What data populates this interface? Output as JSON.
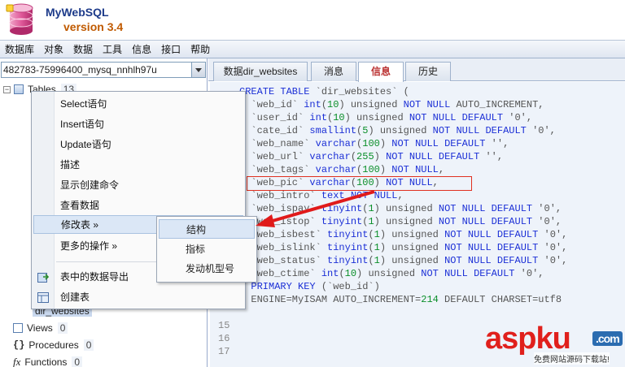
{
  "app": {
    "name": "MyWebSQL",
    "version": "version 3.4"
  },
  "menubar": [
    "数据库",
    "对象",
    "数据",
    "工具",
    "信息",
    "接口",
    "帮助"
  ],
  "database_selector": {
    "value": "482783-75996400_mysq_nnhlh97u"
  },
  "tree": {
    "tables_label": "Tables",
    "tables_count": "13",
    "selected_table": "dir_websites",
    "views_label": "Views",
    "views_count": "0",
    "procedures_label": "Procedures",
    "procedures_count": "0",
    "functions_label": "Functions",
    "functions_count": "0"
  },
  "context_menu": {
    "items": [
      "Select语句",
      "Insert语句",
      "Update语句",
      "描述",
      "显示创建命令",
      "查看数据",
      "修改表 »",
      "更多的操作 »",
      "表中的数据导出",
      "创建表"
    ],
    "submenu": [
      "结构",
      "指标",
      "发动机型号"
    ]
  },
  "tabs": [
    "数据dir_websites",
    "消息",
    "信息",
    "历史"
  ],
  "active_tab": "信息",
  "editor": {
    "lines": [
      {
        "n": "",
        "parts": [
          [
            "kw",
            "CREATE TABLE "
          ],
          [
            "str",
            "`dir_websites` ("
          ]
        ]
      },
      {
        "n": "",
        "parts": [
          [
            "str",
            "  `web_id` "
          ],
          [
            "kw",
            "int"
          ],
          [
            "str",
            "("
          ],
          [
            "num",
            "10"
          ],
          [
            "str",
            ") unsigned "
          ],
          [
            "kw",
            "NOT NULL"
          ],
          [
            "str",
            " AUTO_INCREMENT,"
          ]
        ]
      },
      {
        "n": "",
        "parts": [
          [
            "str",
            "  `user_id` "
          ],
          [
            "kw",
            "int"
          ],
          [
            "str",
            "("
          ],
          [
            "num",
            "10"
          ],
          [
            "str",
            ") unsigned "
          ],
          [
            "kw",
            "NOT NULL DEFAULT"
          ],
          [
            "str",
            " '0',"
          ]
        ]
      },
      {
        "n": "",
        "parts": [
          [
            "str",
            "  `cate_id` "
          ],
          [
            "kw",
            "smallint"
          ],
          [
            "str",
            "("
          ],
          [
            "num",
            "5"
          ],
          [
            "str",
            ") unsigned "
          ],
          [
            "kw",
            "NOT NULL DEFAULT"
          ],
          [
            "str",
            " '0',"
          ]
        ]
      },
      {
        "n": "",
        "parts": [
          [
            "str",
            "  `web_name` "
          ],
          [
            "kw",
            "varchar"
          ],
          [
            "str",
            "("
          ],
          [
            "num",
            "100"
          ],
          [
            "str",
            ") "
          ],
          [
            "kw",
            "NOT NULL DEFAULT"
          ],
          [
            "str",
            " '',"
          ]
        ]
      },
      {
        "n": "",
        "parts": [
          [
            "str",
            "  `web_url` "
          ],
          [
            "kw",
            "varchar"
          ],
          [
            "str",
            "("
          ],
          [
            "num",
            "255"
          ],
          [
            "str",
            ") "
          ],
          [
            "kw",
            "NOT NULL DEFAULT"
          ],
          [
            "str",
            " '',"
          ]
        ]
      },
      {
        "n": "",
        "parts": [
          [
            "str",
            "  `web_tags` "
          ],
          [
            "kw",
            "varchar"
          ],
          [
            "str",
            "("
          ],
          [
            "num",
            "100"
          ],
          [
            "str",
            ") "
          ],
          [
            "kw",
            "NOT NULL"
          ],
          [
            "str",
            ","
          ]
        ]
      },
      {
        "n": "",
        "parts": [
          [
            "str",
            "  `web_pic` "
          ],
          [
            "kw",
            "varchar"
          ],
          [
            "str",
            "("
          ],
          [
            "num",
            "100"
          ],
          [
            "str",
            ") "
          ],
          [
            "kw",
            "NOT NULL"
          ],
          [
            "str",
            ","
          ]
        ]
      },
      {
        "n": "",
        "parts": [
          [
            "str",
            "  `web_intro` "
          ],
          [
            "kw",
            "text NOT NULL"
          ],
          [
            "str",
            ","
          ]
        ]
      },
      {
        "n": "",
        "parts": [
          [
            "str",
            "  `web_ispay` "
          ],
          [
            "kw",
            "tinyint"
          ],
          [
            "str",
            "("
          ],
          [
            "num",
            "1"
          ],
          [
            "str",
            ") unsigned "
          ],
          [
            "kw",
            "NOT NULL DEFAULT"
          ],
          [
            "str",
            " '0',"
          ]
        ]
      },
      {
        "n": "",
        "parts": [
          [
            "str",
            "  `web_istop` "
          ],
          [
            "kw",
            "tinyint"
          ],
          [
            "str",
            "("
          ],
          [
            "num",
            "1"
          ],
          [
            "str",
            ") unsigned "
          ],
          [
            "kw",
            "NOT NULL DEFAULT"
          ],
          [
            "str",
            " '0',"
          ]
        ]
      },
      {
        "n": "",
        "parts": [
          [
            "str",
            "  `web_isbest` "
          ],
          [
            "kw",
            "tinyint"
          ],
          [
            "str",
            "("
          ],
          [
            "num",
            "1"
          ],
          [
            "str",
            ") unsigned "
          ],
          [
            "kw",
            "NOT NULL DEFAULT"
          ],
          [
            "str",
            " '0',"
          ]
        ]
      },
      {
        "n": "",
        "parts": [
          [
            "str",
            "  `web_islink` "
          ],
          [
            "kw",
            "tinyint"
          ],
          [
            "str",
            "("
          ],
          [
            "num",
            "1"
          ],
          [
            "str",
            ") unsigned "
          ],
          [
            "kw",
            "NOT NULL DEFAULT"
          ],
          [
            "str",
            " '0',"
          ]
        ]
      },
      {
        "n": "",
        "parts": [
          [
            "str",
            "  `web_status` "
          ],
          [
            "kw",
            "tinyint"
          ],
          [
            "str",
            "("
          ],
          [
            "num",
            "1"
          ],
          [
            "str",
            ") unsigned "
          ],
          [
            "kw",
            "NOT NULL DEFAULT"
          ],
          [
            "str",
            " '0',"
          ]
        ]
      },
      {
        "n": "",
        "parts": [
          [
            "str",
            "  `web_ctime` "
          ],
          [
            "kw",
            "int"
          ],
          [
            "str",
            "("
          ],
          [
            "num",
            "10"
          ],
          [
            "str",
            ") unsigned "
          ],
          [
            "kw",
            "NOT NULL DEFAULT"
          ],
          [
            "str",
            " '0',"
          ]
        ]
      },
      {
        "n": "",
        "parts": [
          [
            "kw",
            "  PRIMARY KEY"
          ],
          [
            "str",
            " (`web_id`)"
          ]
        ]
      },
      {
        "n": "",
        "parts": [
          [
            "str",
            "  ENGINE=MyISAM AUTO_INCREMENT="
          ],
          [
            "num",
            "214"
          ],
          [
            "str",
            " DEFAULT CHARSET=utf8"
          ]
        ]
      },
      {
        "n": "",
        "parts": []
      },
      {
        "n": "15",
        "parts": []
      },
      {
        "n": "16",
        "parts": []
      },
      {
        "n": "17",
        "parts": []
      }
    ]
  },
  "watermark": {
    "text": "aspku",
    "tag": ".com",
    "sub": "免费网站源码下载站!"
  },
  "colors": {
    "accent_red": "#e03020",
    "keyword_blue": "#1b2fd6",
    "number_green": "#0b8f2a"
  }
}
